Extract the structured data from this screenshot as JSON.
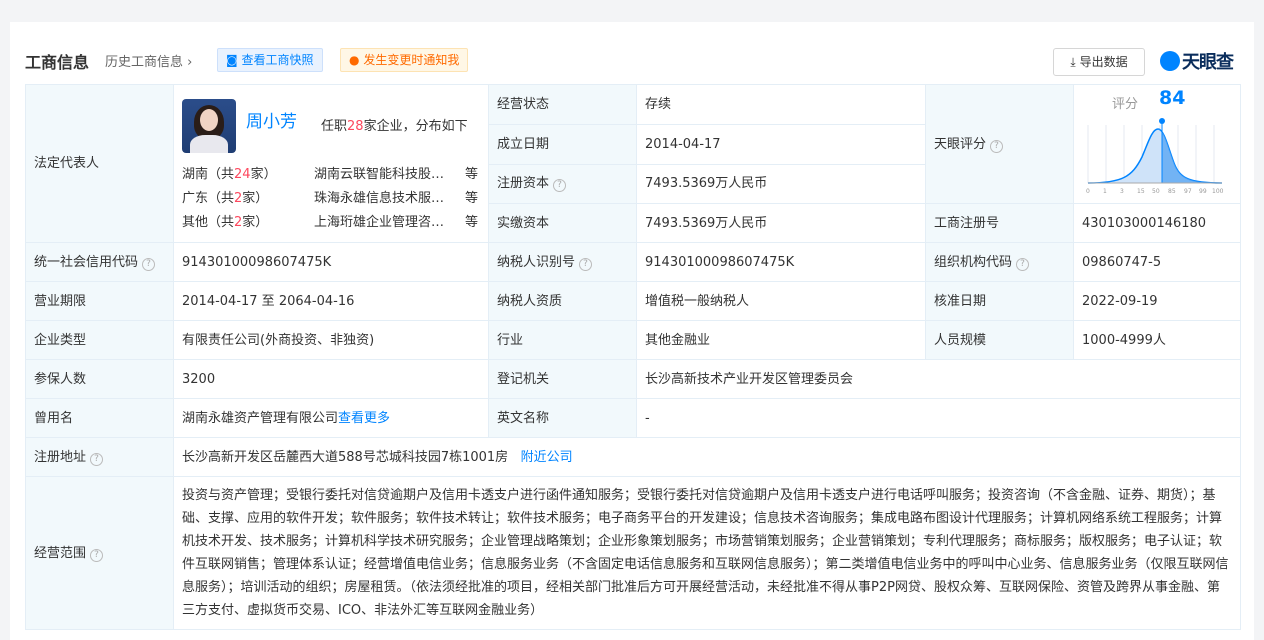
{
  "header": {
    "title": "工商信息",
    "history": "历史工商信息",
    "snapshot_btn": "查看工商快照",
    "notify_btn": "发生变更时通知我",
    "export_btn": "导出数据",
    "logo_text": "天眼查"
  },
  "rep": {
    "label": "法定代表人",
    "name": "周小芳",
    "info_pre": "任职",
    "info_count": "28",
    "info_post": "家企业，分布如下",
    "rows": [
      {
        "region": "湖南（共",
        "count": "24",
        "suffix": "家）",
        "company": "湖南云联智能科技股份有限公司",
        "more": "等"
      },
      {
        "region": "广东（共",
        "count": "2",
        "suffix": "家）",
        "company": "珠海永雄信息技术服务有限公司",
        "more": "等"
      },
      {
        "region": "其他（共",
        "count": "2",
        "suffix": "家）",
        "company": "上海珩雄企业管理咨询有限公司",
        "more": "等"
      }
    ]
  },
  "fields": {
    "status_l": "经营状态",
    "status_v": "存续",
    "found_l": "成立日期",
    "found_v": "2014-04-17",
    "regcap_l": "注册资本",
    "regcap_v": "7493.5369万人民币",
    "paidcap_l": "实缴资本",
    "paidcap_v": "7493.5369万人民币",
    "score_l": "天眼评分",
    "regno_l": "工商注册号",
    "regno_v": "430103000146180",
    "credit_l": "统一社会信用代码",
    "credit_v": "91430100098607475K",
    "taxid_l": "纳税人识别号",
    "taxid_v": "91430100098607475K",
    "org_l": "组织机构代码",
    "org_v": "09860747-5",
    "term_l": "营业期限",
    "term_v": "2014-04-17 至 2064-04-16",
    "taxq_l": "纳税人资质",
    "taxq_v": "增值税一般纳税人",
    "appr_l": "核准日期",
    "appr_v": "2022-09-19",
    "type_l": "企业类型",
    "type_v": "有限责任公司(外商投资、非独资)",
    "ind_l": "行业",
    "ind_v": "其他金融业",
    "staff_l": "人员规模",
    "staff_v": "1000-4999人",
    "ins_l": "参保人数",
    "ins_v": "3200",
    "auth_l": "登记机关",
    "auth_v": "长沙高新技术产业开发区管理委员会",
    "used_l": "曾用名",
    "used_v": "湖南永雄资产管理有限公司",
    "used_more": "查看更多",
    "eng_l": "英文名称",
    "eng_v": "-",
    "addr_l": "注册地址",
    "addr_v": "长沙高新开发区岳麓西大道588号芯城科技园7栋1001房",
    "addr_link": "附近公司",
    "scope_l": "经营范围",
    "scope_v": "投资与资产管理；受银行委托对信贷逾期户及信用卡透支户进行函件通知服务；受银行委托对信贷逾期户及信用卡透支户进行电话呼叫服务；投资咨询（不含金融、证券、期货）；基础、支撑、应用的软件开发；软件服务；软件技术转让；软件技术服务；电子商务平台的开发建设；信息技术咨询服务；集成电路布图设计代理服务；计算机网络系统工程服务；计算机技术开发、技术服务；计算机科学技术研究服务；企业管理战略策划；企业形象策划服务；市场营销策划服务；企业营销策划；专利代理服务；商标服务；版权服务；电子认证；软件互联网销售；管理体系认证；经营增值电信业务；信息服务业务（不含固定电话信息服务和互联网信息服务）；第二类增值电信业务中的呼叫中心业务、信息服务业务（仅限互联网信息服务）；培训活动的组织；房屋租赁。（依法须经批准的项目，经相关部门批准后方可开展经营活动，未经批准不得从事P2P网贷、股权众筹、互联网保险、资管及跨界从事金融、第三方支付、虚拟货币交易、ICO、非法外汇等互联网金融业务）"
  },
  "score": {
    "label": "评分",
    "value": "84",
    "axis": [
      "0",
      "1",
      "3",
      "15",
      "50",
      "85",
      "97",
      "99",
      "100"
    ]
  },
  "colors": {
    "accent": "#0084ff",
    "label_bg": "#f2f9fc",
    "warn": "#ff6a00",
    "red": "#fd485e"
  }
}
